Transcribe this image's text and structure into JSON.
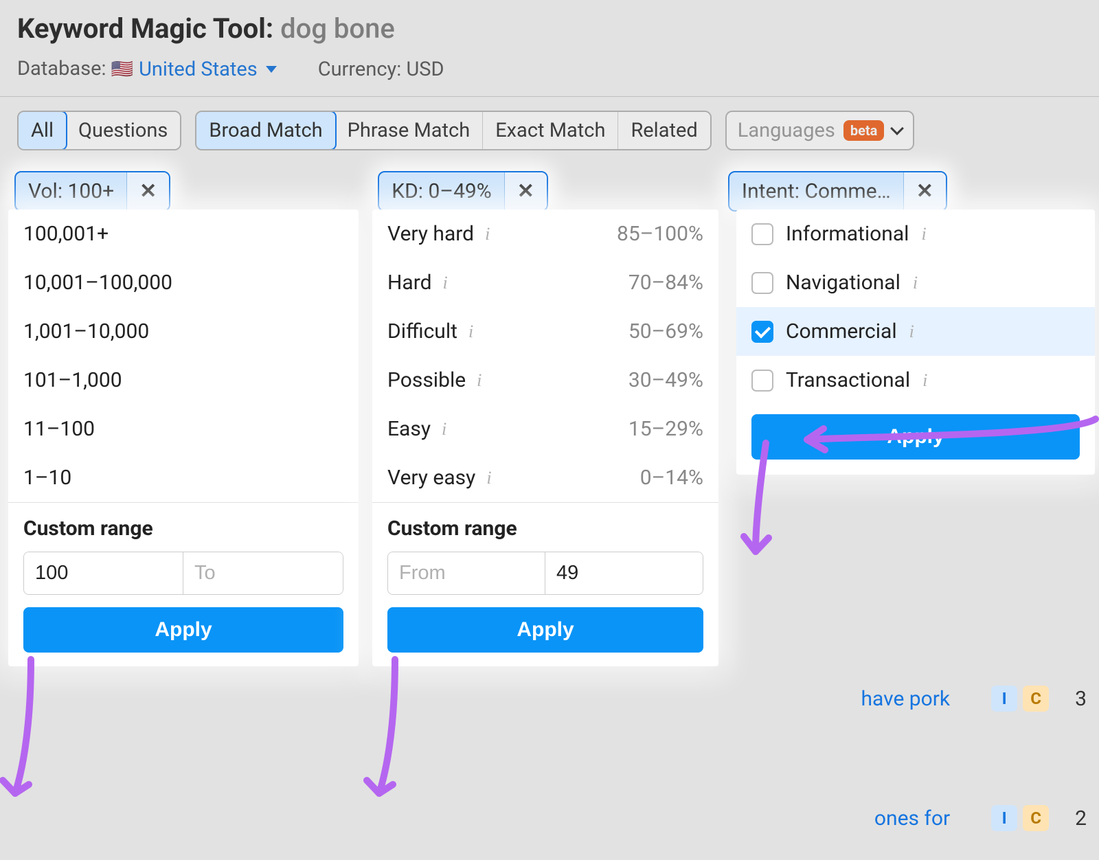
{
  "header": {
    "title_prefix": "Keyword Magic Tool:",
    "keyword": "dog bone",
    "database_label": "Database:",
    "database_value": "United States",
    "currency_label": "Currency:",
    "currency_value": "USD"
  },
  "tabs": {
    "group1": [
      "All",
      "Questions"
    ],
    "group1_active": "All",
    "group2": [
      "Broad Match",
      "Phrase Match",
      "Exact Match",
      "Related"
    ],
    "group2_active": "Broad Match",
    "languages_label": "Languages",
    "beta": "beta"
  },
  "chips": {
    "vol": "Vol: 100+",
    "kd": "KD: 0–49%",
    "intent": "Intent: Comme…"
  },
  "vol_dropdown": {
    "options": [
      "100,001+",
      "10,001–100,000",
      "1,001–10,000",
      "101–1,000",
      "11–100",
      "1–10"
    ],
    "custom_label": "Custom range",
    "from_value": "100",
    "to_placeholder": "To",
    "apply": "Apply"
  },
  "kd_dropdown": {
    "options": [
      {
        "label": "Very hard",
        "range": "85–100%"
      },
      {
        "label": "Hard",
        "range": "70–84%"
      },
      {
        "label": "Difficult",
        "range": "50–69%"
      },
      {
        "label": "Possible",
        "range": "30–49%"
      },
      {
        "label": "Easy",
        "range": "15–29%"
      },
      {
        "label": "Very easy",
        "range": "0–14%"
      }
    ],
    "custom_label": "Custom range",
    "from_placeholder": "From",
    "to_value": "49",
    "apply": "Apply"
  },
  "intent_dropdown": {
    "options": [
      {
        "label": "Informational",
        "checked": false
      },
      {
        "label": "Navigational",
        "checked": false
      },
      {
        "label": "Commercial",
        "checked": true
      },
      {
        "label": "Transactional",
        "checked": false
      }
    ],
    "apply": "Apply"
  },
  "bg_rows": [
    {
      "text": "have pork",
      "badges": [
        "I",
        "C"
      ],
      "num": "3"
    },
    {
      "text": "ones for",
      "badges": [
        "I",
        "C"
      ],
      "num": "2"
    }
  ],
  "colors": {
    "accent_blue": "#0a94f7",
    "link_blue": "#1675e0",
    "highlight_purple": "#b566f0",
    "beta_orange": "#f26522"
  }
}
